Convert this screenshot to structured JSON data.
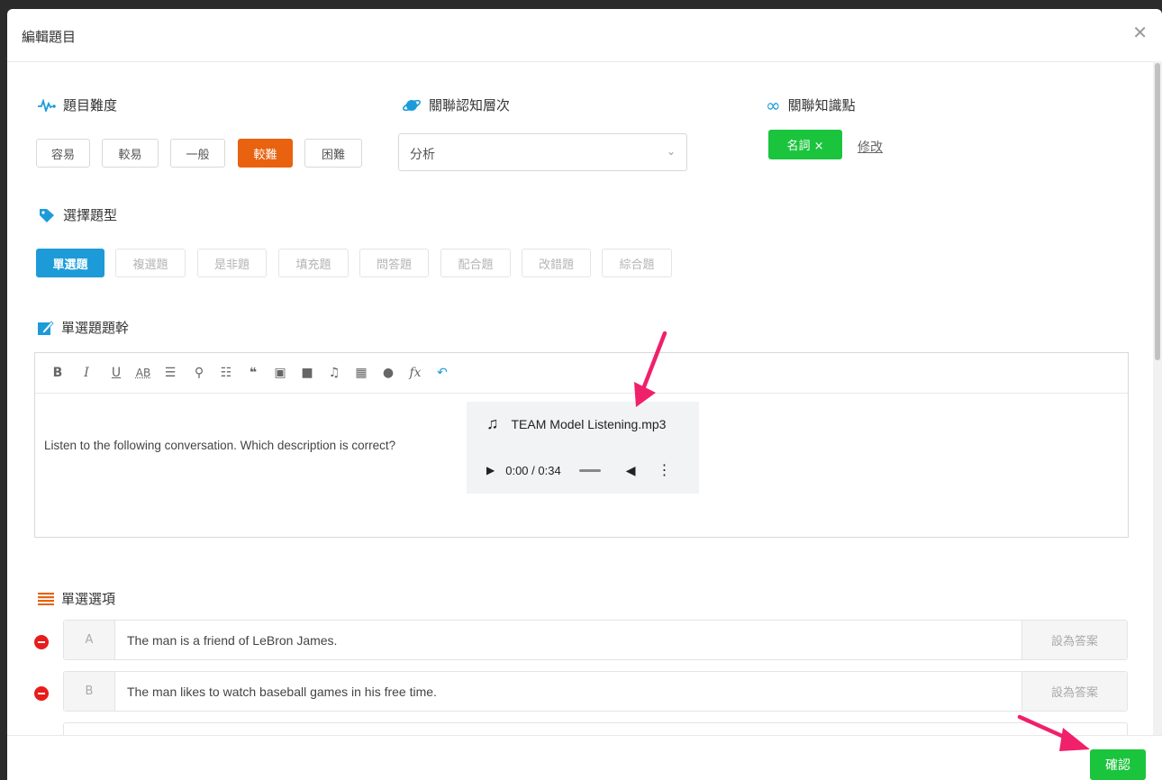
{
  "modal": {
    "title": "編輯題目"
  },
  "difficulty": {
    "label": "題目難度",
    "options": [
      "容易",
      "較易",
      "一般",
      "較難",
      "困難"
    ],
    "selected": "較難"
  },
  "cognitive": {
    "label": "關聯認知層次",
    "value": "分析"
  },
  "knowledge": {
    "label": "關聯知識點",
    "tag": "名詞 ×",
    "modify": "修改"
  },
  "qtype": {
    "label": "選擇題型",
    "options": [
      "單選題",
      "複選題",
      "是非題",
      "填充題",
      "問答題",
      "配合題",
      "改錯題",
      "綜合題"
    ],
    "selected": "單選題"
  },
  "stem": {
    "label": "單選題題幹",
    "text": "Listen to the following conversation. Which description is correct?",
    "audio": {
      "filename": "TEAM Model Listening.mp3",
      "time": "0:00 / 0:34"
    }
  },
  "choices": {
    "label": "單選選項",
    "items": [
      {
        "letter": "A",
        "text": "The man is a friend of LeBron James.",
        "action": "設為答案"
      },
      {
        "letter": "B",
        "text": "The man likes to watch baseball games in his free time.",
        "action": "設為答案"
      }
    ]
  },
  "footer": {
    "confirm": "確認"
  },
  "colors": {
    "orange": "#e8620f",
    "blue": "#1c9bd8",
    "green": "#1bc43d",
    "red": "#e81c1c",
    "arrow": "#f0206a"
  }
}
